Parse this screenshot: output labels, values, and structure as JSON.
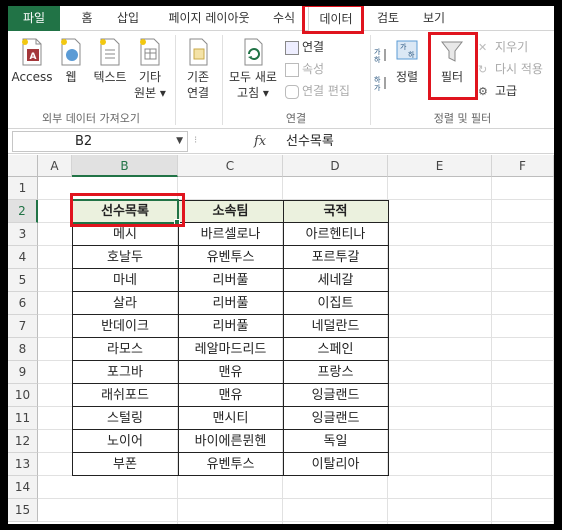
{
  "tabs": [
    {
      "label": "파일"
    },
    {
      "label": "홈"
    },
    {
      "label": "삽입"
    },
    {
      "label": "페이지 레이아웃"
    },
    {
      "label": "수식"
    },
    {
      "label": "데이터"
    },
    {
      "label": "검토"
    },
    {
      "label": "보기"
    }
  ],
  "ribbon": {
    "external": {
      "access": "Access",
      "web": "웹",
      "text": "텍스트",
      "other_line1": "기타",
      "other_line2": "원본 ▾",
      "group_label": "외부 데이터 가져오기"
    },
    "existing": {
      "line1": "기존",
      "line2": "연결"
    },
    "connections": {
      "refresh_line1": "모두 새로",
      "refresh_line2": "고침 ▾",
      "connections": "연결",
      "properties": "속성",
      "edit_links": "연결 편집",
      "group_label": "연결"
    },
    "sort_filter": {
      "sort": "정렬",
      "filter": "필터",
      "clear": "지우기",
      "reapply": "다시 적용",
      "advanced": "고급",
      "group_label": "정렬 및 필터"
    }
  },
  "formula_bar": {
    "name_box": "B2",
    "fx": "fx",
    "formula": "선수목록"
  },
  "grid": {
    "columns": [
      "A",
      "B",
      "C",
      "D",
      "E",
      "F"
    ],
    "rows": [
      "1",
      "2",
      "3",
      "4",
      "5",
      "6",
      "7",
      "8",
      "9",
      "10",
      "11",
      "12",
      "13",
      "14",
      "15"
    ],
    "table_headers": [
      "선수목록",
      "소속팀",
      "국적"
    ],
    "table_rows": [
      [
        "메시",
        "바르셀로나",
        "아르헨티나"
      ],
      [
        "호날두",
        "유벤투스",
        "포르투갈"
      ],
      [
        "마네",
        "리버풀",
        "세네갈"
      ],
      [
        "살라",
        "리버풀",
        "이집트"
      ],
      [
        "반데이크",
        "리버풀",
        "네덜란드"
      ],
      [
        "라모스",
        "레알마드리드",
        "스페인"
      ],
      [
        "포그바",
        "맨유",
        "프랑스"
      ],
      [
        "래쉬포드",
        "맨유",
        "잉글랜드"
      ],
      [
        "스털링",
        "맨시티",
        "잉글랜드"
      ],
      [
        "노이어",
        "바이에른뮌헨",
        "독일"
      ],
      [
        "부폰",
        "유벤투스",
        "이탈리아"
      ]
    ]
  },
  "colors": {
    "accent": "#217346",
    "highlight": "#e0141e",
    "header_fill": "#ebf1de"
  }
}
